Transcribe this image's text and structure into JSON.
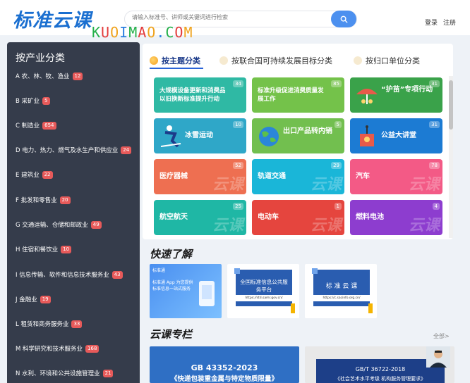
{
  "header": {
    "logo": "标准云课",
    "watermark": [
      "K",
      "U",
      "O",
      "I",
      "M",
      "A",
      "O",
      ".",
      "C",
      "O",
      "M"
    ],
    "search_placeholder": "请输入标准号、讲师或关键词进行检索",
    "login": "登录",
    "register": "注册"
  },
  "sidebar": {
    "title": "按产业分类",
    "items": [
      {
        "label": "A 农、林、牧、渔业",
        "count": "12"
      },
      {
        "label": "B 采矿业",
        "count": "5"
      },
      {
        "label": "C 制造业",
        "count": "654"
      },
      {
        "label": "D 电力、热力、燃气及水生产和供应业",
        "count": "24"
      },
      {
        "label": "E 建筑业",
        "count": "22"
      },
      {
        "label": "F 批发和零售业",
        "count": "20"
      },
      {
        "label": "G 交通运输、仓储和邮政业",
        "count": "49"
      },
      {
        "label": "H 住宿和餐饮业",
        "count": "10"
      },
      {
        "label": "I 信息传输、软件和信息技术服务业",
        "count": "43"
      },
      {
        "label": "J 金融业",
        "count": "19"
      },
      {
        "label": "L 租赁和商务服务业",
        "count": "33"
      },
      {
        "label": "M 科学研究和技术服务业",
        "count": "168"
      },
      {
        "label": "N 水利、环境和公共设施管理业",
        "count": "21"
      }
    ]
  },
  "tabs": [
    {
      "label": "按主题分类"
    },
    {
      "label": "按联合国可持续发展目标分类"
    },
    {
      "label": "按归口单位分类"
    }
  ],
  "cards": [
    {
      "label": "大规模设备更新和消费品以旧换新标准提升行动",
      "count": "34",
      "color": "#2fb9a4"
    },
    {
      "label": "标准升级促进消费质量发展工作",
      "count": "85",
      "color": "#74c24a"
    },
    {
      "label": "“护苗”专项行动",
      "count": "31",
      "color": "#3aa24a"
    },
    {
      "label": "冰雪运动",
      "count": "10",
      "color": "#2fa7c8"
    },
    {
      "label": "出口产品转内销",
      "count": "5",
      "color": "#72bf4f"
    },
    {
      "label": "公益大讲堂",
      "count": "31",
      "color": "#1c7bd3"
    },
    {
      "label": "医疗器械",
      "count": "52",
      "color": "#ee6f51"
    },
    {
      "label": "轨道交通",
      "count": "29",
      "color": "#1ab6d8"
    },
    {
      "label": "汽车",
      "count": "78",
      "color": "#f35a86"
    },
    {
      "label": "航空航天",
      "count": "25",
      "color": "#1fb7a5"
    },
    {
      "label": "电动车",
      "count": "1",
      "color": "#e5453e"
    },
    {
      "label": "燃料电池",
      "count": "4",
      "color": "#8d3dcf"
    }
  ],
  "card_watermark": "云课",
  "quick": {
    "title": "快速了解",
    "items": [
      {
        "title": "标准通 App 为您提供标准信息一站式服务",
        "label": "标准通"
      },
      {
        "title": "全国标准信息公共服务平台",
        "url": "https://std.samr.gov.cn/"
      },
      {
        "title": "标 准 云 课",
        "url": "https://c.sacinfo.org.cn/"
      }
    ]
  },
  "column": {
    "title": "云课专栏",
    "more": "全部>",
    "items": [
      {
        "code": "GB 43352-2023",
        "name": "《快递包装重金属与特定物质限量》"
      },
      {
        "code": "GB/T 36722-2018",
        "name": "《社会艺术水平考级 机构服务管理要求》"
      }
    ]
  }
}
